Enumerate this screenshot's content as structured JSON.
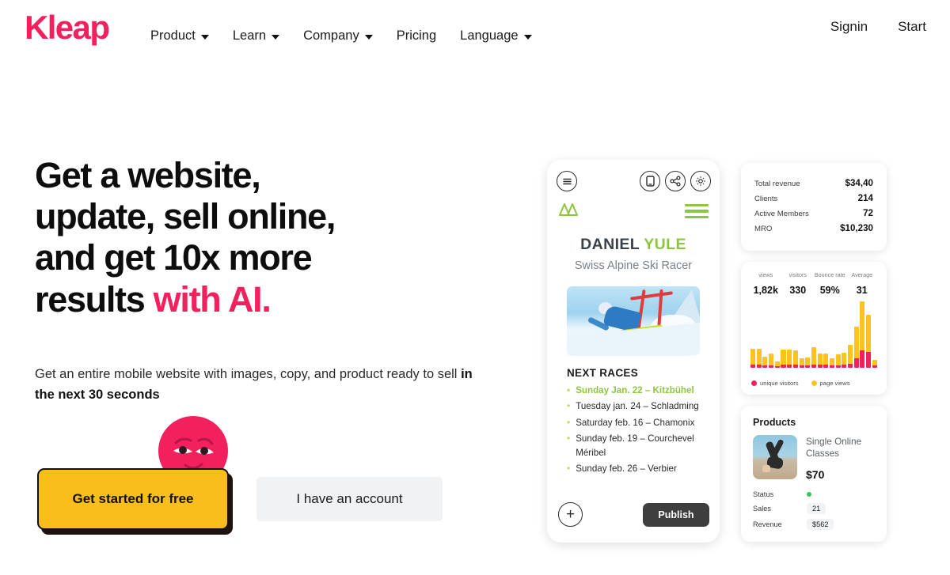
{
  "header": {
    "logo": "Kleap",
    "logo_color": "#F2205C",
    "nav": [
      {
        "label": "Product",
        "has_caret": true
      },
      {
        "label": "Learn",
        "has_caret": true
      },
      {
        "label": "Company",
        "has_caret": true
      },
      {
        "label": "Pricing",
        "has_caret": false
      },
      {
        "label": "Language",
        "has_caret": true
      }
    ],
    "signin": "Signin",
    "start": "Start"
  },
  "hero": {
    "headline_line1": "Get a website,",
    "headline_line2": "update, sell online,",
    "headline_line3": "and get 10x more",
    "headline_line4_plain": "results ",
    "headline_line4_accent": "with AI.",
    "subhead_plain": "Get an entire mobile website with images, copy, and product ready to sell ",
    "subhead_bold": "in the next 30 seconds",
    "cta_primary": "Get started for free",
    "cta_primary_color": "#F9BE1B",
    "cta_secondary": "I have an account"
  },
  "phone": {
    "toolbar_icons": [
      "menu-icon",
      "device-icon",
      "share-icon",
      "gear-icon"
    ],
    "brand_icon": "mountain-logo-icon",
    "menu_icon": "hamburger-icon",
    "name_first": "DANIEL ",
    "name_last": "YULE",
    "subtitle": "Swiss Alpine Ski Racer",
    "photo_alt": "alpine-ski-racer-photo",
    "races_title": "NEXT RACES",
    "races": [
      {
        "text": "Sunday Jan. 22 – Kitzbühel",
        "highlight": true
      },
      {
        "text": "Tuesday jan. 24  – Schladming",
        "highlight": false
      },
      {
        "text": "Saturday feb. 16 – Chamonix",
        "highlight": false
      },
      {
        "text": "Sunday feb. 19 – Courchevel Méribel",
        "highlight": false
      },
      {
        "text": "Sunday feb. 26 – Verbier",
        "highlight": false
      }
    ],
    "add_label": "+",
    "publish_label": "Publish",
    "accent_green": "#8CC63E"
  },
  "stats_card": {
    "rows": [
      {
        "label": "Total revenue",
        "value": "$34,40"
      },
      {
        "label": "Clients",
        "value": "214"
      },
      {
        "label": "Active Members",
        "value": "72"
      },
      {
        "label": "MRO",
        "value": "$10,230"
      }
    ]
  },
  "analytics_card": {
    "metrics": [
      {
        "key": "views",
        "value": "1,82k"
      },
      {
        "key": "visitors",
        "value": "330"
      },
      {
        "key": "Bounce rate",
        "value": "59%"
      },
      {
        "key": "Average",
        "value": "31"
      }
    ],
    "legend": [
      {
        "label": "unique visitors",
        "color": "#F2205C"
      },
      {
        "label": "page views",
        "color": "#FFC220"
      }
    ]
  },
  "chart_data": {
    "type": "bar",
    "title": "",
    "xlabel": "",
    "ylabel": "",
    "stacked": true,
    "grid": false,
    "legend_position": "bottom",
    "categories": [
      "1",
      "2",
      "3",
      "4",
      "5",
      "6",
      "7",
      "8",
      "9",
      "10",
      "11",
      "12",
      "13",
      "14",
      "15",
      "16",
      "17",
      "18",
      "19",
      "20",
      "21"
    ],
    "series": [
      {
        "name": "page views",
        "color": "#FFC220",
        "values": [
          20,
          20,
          11,
          15,
          6,
          19,
          19,
          18,
          9,
          10,
          22,
          14,
          14,
          9,
          14,
          15,
          24,
          40,
          62,
          47,
          7
        ]
      },
      {
        "name": "unique visitors",
        "color": "#F2205C",
        "values": [
          4,
          4,
          3,
          3,
          2,
          4,
          4,
          4,
          3,
          3,
          4,
          4,
          4,
          3,
          3,
          4,
          5,
          12,
          22,
          20,
          3
        ]
      }
    ],
    "ylim": [
      0,
      68
    ]
  },
  "products_card": {
    "title": "Products",
    "product_name": "Single Online Classes",
    "product_price": "$70",
    "thumb_alt": "yoga-handstand-photo",
    "rows": [
      {
        "label": "Status",
        "value": "",
        "dot": true
      },
      {
        "label": "Sales",
        "value": "21",
        "dot": false
      },
      {
        "label": "Revenue",
        "value": "$562",
        "dot": false
      }
    ]
  }
}
